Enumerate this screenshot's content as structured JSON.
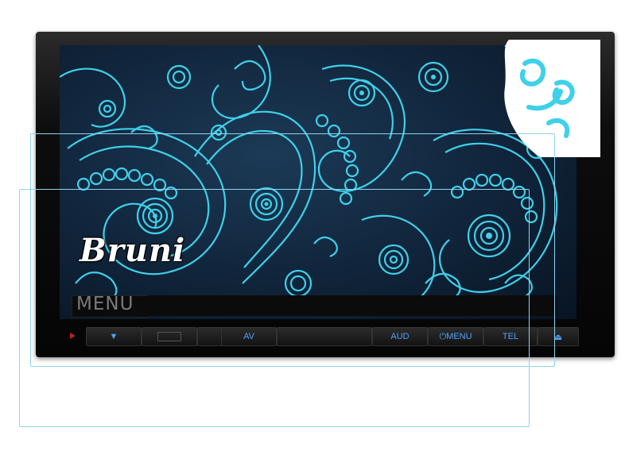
{
  "logo": "Bruni",
  "display": {
    "menu_label": "MENU"
  },
  "buttons": [
    {
      "id": "power",
      "label": ""
    },
    {
      "id": "down",
      "label": "▼"
    },
    {
      "id": "slot",
      "label": ""
    },
    {
      "id": "up",
      "label": "▲"
    },
    {
      "id": "av",
      "label": "AV"
    },
    {
      "id": "blank",
      "label": ""
    },
    {
      "id": "aud",
      "label": "AUD"
    },
    {
      "id": "menu",
      "label": "⏻MENU"
    },
    {
      "id": "tel",
      "label": "TEL"
    },
    {
      "id": "eject",
      "label": "⏏"
    }
  ],
  "colors": {
    "pattern": "#3fd0ea",
    "button_text": "#4da3ff",
    "protector": "#8fd4ee"
  }
}
